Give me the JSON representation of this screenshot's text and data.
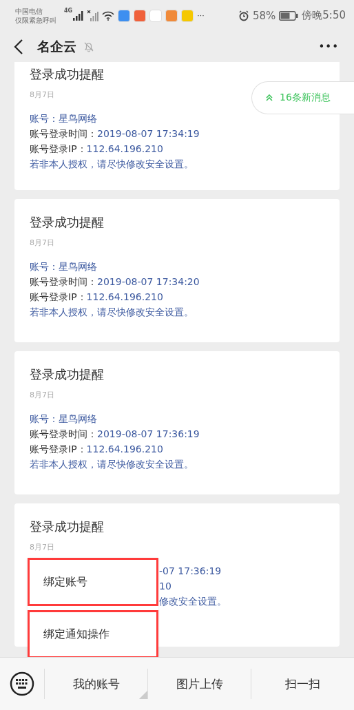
{
  "status_bar": {
    "carrier": [
      "中国电信",
      "仅限紧急呼叫"
    ],
    "network": "4G",
    "app_icons": [
      {
        "color": "#3d8ff0"
      },
      {
        "color": "#f0603a"
      },
      {
        "color": "#ffffff"
      },
      {
        "color": "#f08a3a"
      },
      {
        "color": "#f5c800"
      }
    ],
    "more": "···",
    "battery": "58%",
    "time": "傍晚5:50"
  },
  "header": {
    "title": "名企云",
    "muted": true,
    "more": "•••"
  },
  "new_messages": "16条新消息",
  "cards": [
    {
      "title": "登录成功提醒",
      "date": "8月7日",
      "lines": [
        {
          "label": "账号：",
          "value": "星鸟网络",
          "kind": "plain"
        },
        {
          "label": "账号登录时间：",
          "value": "2019-08-07 17:34:19",
          "kind": "field"
        },
        {
          "label": "账号登录IP：",
          "value": "112.64.196.210",
          "kind": "field"
        },
        {
          "value": "若非本人授权，请尽快修改安全设置。",
          "kind": "plain"
        }
      ],
      "top_cut": true
    },
    {
      "title": "登录成功提醒",
      "date": "8月7日",
      "lines": [
        {
          "label": "账号：",
          "value": "星鸟网络",
          "kind": "plain"
        },
        {
          "label": "账号登录时间：",
          "value": "2019-08-07 17:34:20",
          "kind": "field"
        },
        {
          "label": "账号登录IP：",
          "value": "112.64.196.210",
          "kind": "field"
        },
        {
          "value": "若非本人授权，请尽快修改安全设置。",
          "kind": "plain"
        }
      ],
      "top_cut": false
    },
    {
      "title": "登录成功提醒",
      "date": "8月7日",
      "lines": [
        {
          "label": "账号：",
          "value": "星鸟网络",
          "kind": "plain"
        },
        {
          "label": "账号登录时间：",
          "value": "2019-08-07 17:36:19",
          "kind": "field"
        },
        {
          "label": "账号登录IP：",
          "value": "112.64.196.210",
          "kind": "field"
        },
        {
          "value": "若非本人授权，请尽快修改安全设置。",
          "kind": "plain"
        }
      ],
      "top_cut": false
    },
    {
      "title": "登录成功提醒",
      "date": "8月7日",
      "lines": [
        {
          "value": "-07 17:36:19",
          "kind": "covered"
        },
        {
          "value": "10",
          "kind": "covered"
        },
        {
          "value": "修改安全设置。",
          "kind": "covered"
        }
      ],
      "top_cut": false
    }
  ],
  "popup_menu": [
    {
      "label": "绑定账号"
    },
    {
      "label": "绑定通知操作"
    }
  ],
  "bottom_menu": [
    {
      "label": "我的账号",
      "submenu": true
    },
    {
      "label": "图片上传",
      "submenu": false
    },
    {
      "label": "扫一扫",
      "submenu": false
    }
  ]
}
